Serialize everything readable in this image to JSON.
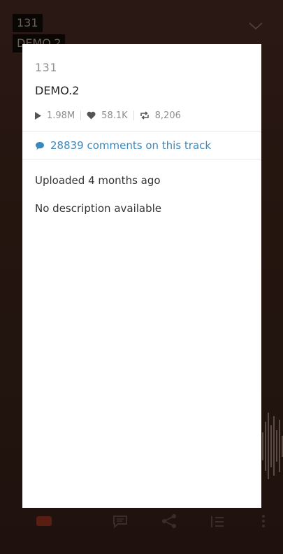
{
  "background": {
    "artist": "131",
    "title": "DEMO.2",
    "icons": [
      "chevron-down-icon",
      "heart-icon",
      "comment-icon",
      "share-icon",
      "queue-icon",
      "more-icon"
    ]
  },
  "track_info": {
    "artist": "131",
    "title": "DEMO.2",
    "plays": "1.98M",
    "likes": "58.1K",
    "reposts": "8,206",
    "comments_link": "28839 comments on this track",
    "uploaded": "Uploaded 4 months ago",
    "description": "No description available"
  },
  "colors": {
    "link": "#3a88bd",
    "muted": "#8e8e8e",
    "text": "#333333"
  }
}
